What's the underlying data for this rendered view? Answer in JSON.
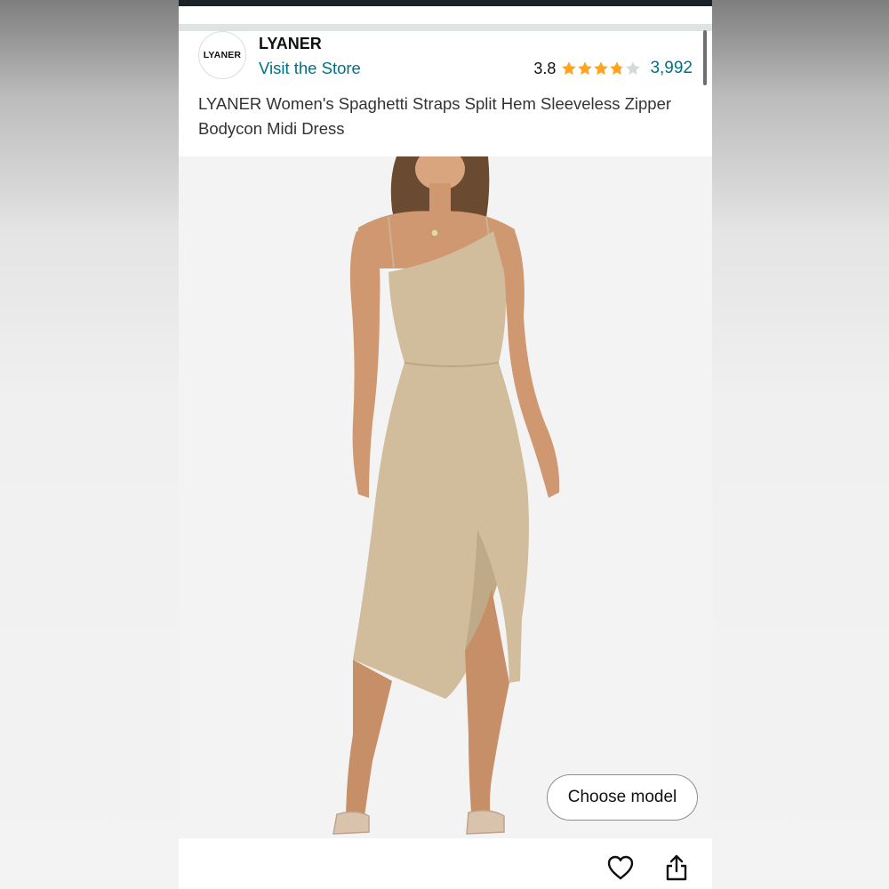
{
  "brand": {
    "logo_text": "LYANER",
    "name": "LYANER",
    "store_link": "Visit the Store"
  },
  "rating": {
    "value": "3.8",
    "stars": 3.8,
    "review_count": "3,992",
    "star_color": "#ffa41c"
  },
  "product": {
    "title": "LYANER Women's Spaghetti Straps Split Hem Sleeveless Zipper Bodycon Midi Dress",
    "image": "model-in-beige-midi-dress"
  },
  "buttons": {
    "choose_model": "Choose model"
  },
  "icons": {
    "wishlist": "heart-icon",
    "share": "share-icon"
  },
  "colors": {
    "link": "#007185",
    "dress": "#d1bc9c"
  }
}
